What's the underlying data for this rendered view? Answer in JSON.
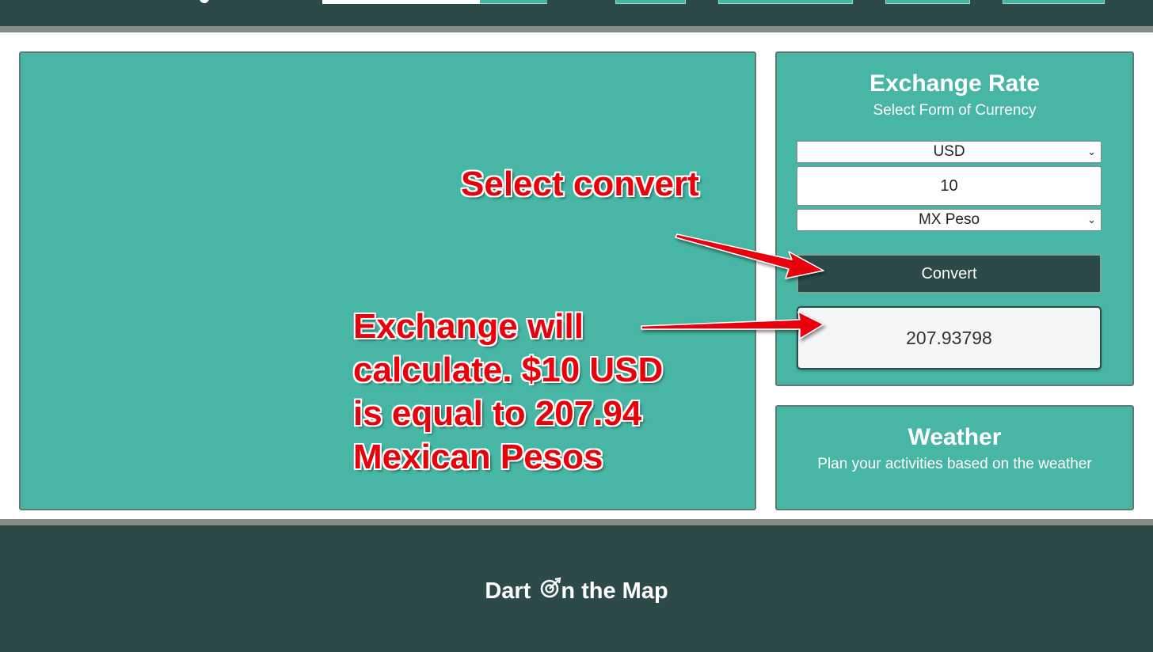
{
  "exchange": {
    "title": "Exchange Rate",
    "subtitle": "Select Form of Currency",
    "from_currency": "USD",
    "amount": "10",
    "to_currency": "MX Peso",
    "convert_label": "Convert",
    "result": "207.93798"
  },
  "weather": {
    "title": "Weather",
    "subtitle": "Plan your activities based on the weather"
  },
  "annotations": {
    "convert_note": "Select convert",
    "result_note": "Exchange will calculate. $10 USD is equal to 207.94 Mexican Pesos"
  },
  "footer": {
    "brand_part1": "Dart",
    "brand_part2": "n the Map",
    "brand_icon": "dart-target-icon"
  },
  "colors": {
    "nav_bg": "#2b4a48",
    "panel_bg": "#48b6a4",
    "annotation_red": "#e8000a",
    "divider": "#858d86"
  }
}
